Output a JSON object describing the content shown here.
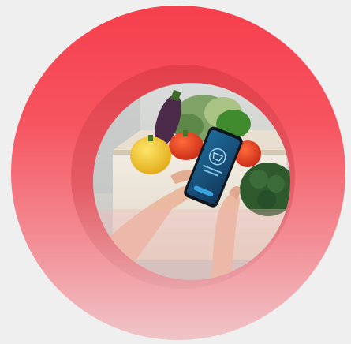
{
  "image": {
    "subject": "hands-holding-smartphone-over-grocery-box",
    "colors": {
      "outer_ring_top": "#f63f4d",
      "outer_ring_bottom": "#efc5c8",
      "inner_ring": "#e23e48",
      "background": "#efefef",
      "phone_screen": "#1b4f7a"
    }
  }
}
